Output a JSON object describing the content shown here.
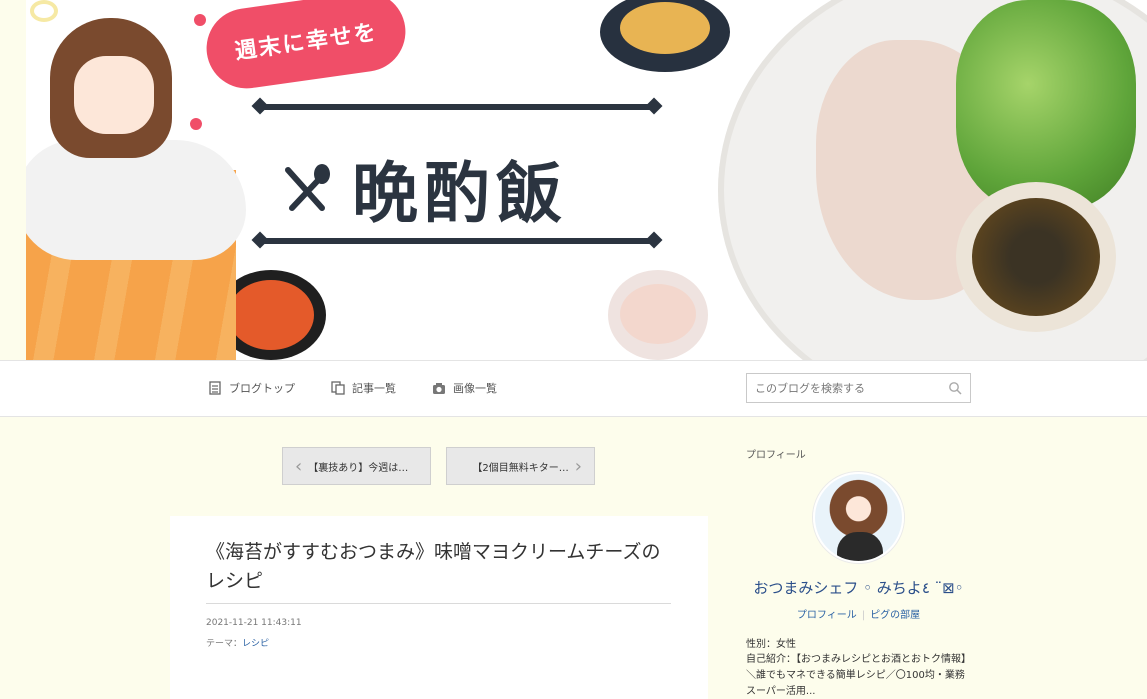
{
  "header": {
    "tagline": "週末に幸せを",
    "blog_title": "晩酌飯"
  },
  "nav": {
    "items": [
      {
        "label": "ブログトップ",
        "icon": "document-icon"
      },
      {
        "label": "記事一覧",
        "icon": "copy-icon"
      },
      {
        "label": "画像一覧",
        "icon": "camera-icon"
      }
    ],
    "search_placeholder": "このブログを検索する"
  },
  "pager": {
    "prev_label": "【裏技あり】今週は…",
    "next_label": "【2個目無料キター…"
  },
  "article": {
    "title": "《海苔がすすむおつまみ》味噌マヨクリームチーズのレシピ",
    "date": "2021-11-21 11:43:11",
    "theme_prefix": "テーマ：",
    "theme": "レシピ"
  },
  "profile": {
    "heading": "プロフィール",
    "name": "おつまみシェフ ◦ みちよ٤ ¨⊠◦",
    "link_profile": "プロフィール",
    "link_room": "ピグの部屋",
    "gender": "性別：女性",
    "intro": "自己紹介：【おつまみレシピとお酒とおトク情報】＼誰でもマネできる簡単レシピ／〇100均・業務スーパー活用..."
  },
  "colors": {
    "accent_pink": "#f04e68",
    "link_blue": "#2b62a4",
    "name_blue": "#2b4f8a",
    "background": "#fdfdec",
    "title_navy": "#2b3440"
  }
}
